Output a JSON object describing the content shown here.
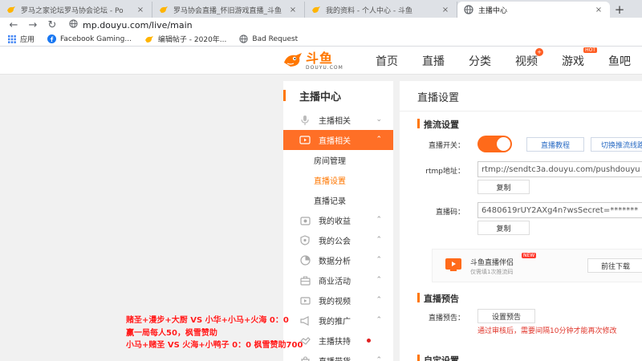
{
  "browser": {
    "tabs": [
      {
        "title": "罗马之家论坛罗马协会论坛 - Po",
        "close": "×",
        "icon": "bird-icon"
      },
      {
        "title": "罗马协会直播_怀旧游戏直播_斗鱼",
        "close": "×",
        "icon": "bird-icon"
      },
      {
        "title": "我的资料 - 个人中心 - 斗鱼",
        "close": "×",
        "icon": "bird-icon"
      },
      {
        "title": "主播中心",
        "close": "×",
        "icon": "globe-icon"
      }
    ],
    "new_tab": "+",
    "back": "←",
    "forward": "→",
    "reload": "↻",
    "url": "mp.douyu.com/live/main",
    "bookmarks": [
      {
        "label": "应用",
        "icon": "apps-icon"
      },
      {
        "label": "Facebook Gaming...",
        "icon": "facebook-icon"
      },
      {
        "label": "编辑帖子 - 2020年...",
        "icon": "bird-icon"
      },
      {
        "label": "Bad Request",
        "icon": "globe-icon"
      }
    ]
  },
  "site": {
    "logo_cn": "斗鱼",
    "logo_en": "DOUYU.COM",
    "nav": [
      "首页",
      "直播",
      "分类",
      "视频",
      "游戏",
      "鱼吧"
    ],
    "video_badge": "+",
    "game_badge": "HOT"
  },
  "sidebar": {
    "title": "主播中心",
    "items": [
      {
        "label": "主播相关",
        "icon": "microphone-icon",
        "chevron": "⌄"
      },
      {
        "label": "直播相关",
        "icon": "live-tv-icon",
        "chevron": "⌃"
      },
      {
        "label": "我的收益",
        "icon": "wallet-icon",
        "chevron": "⌃"
      },
      {
        "label": "我的公会",
        "icon": "shield-icon",
        "chevron": "⌃"
      },
      {
        "label": "数据分析",
        "icon": "pie-chart-icon",
        "chevron": "⌃"
      },
      {
        "label": "商业活动",
        "icon": "briefcase-icon",
        "chevron": "⌃"
      },
      {
        "label": "我的视频",
        "icon": "video-icon",
        "chevron": "⌃"
      },
      {
        "label": "我的推广",
        "icon": "megaphone-icon",
        "chevron": "⌃"
      },
      {
        "label": "主播扶持",
        "icon": "support-icon",
        "chevron": ""
      },
      {
        "label": "直播带货",
        "icon": "shopping-icon",
        "chevron": "⌃"
      }
    ],
    "sub_items": [
      "房间管理",
      "直播设置",
      "直播记录"
    ]
  },
  "main": {
    "title": "直播设置",
    "sections": {
      "push": "推流设置",
      "preview": "直播预告",
      "custom": "自定设置"
    },
    "switch_label": "直播开关：",
    "switch_on": true,
    "tutorial_button": "直播教程",
    "switch_line_button": "切换推流线路",
    "rtmp_label": "rtmp地址：",
    "rtmp_value": "rtmp://sendtc3a.douyu.com/pushdouyu",
    "copy_button": "复制",
    "code_label": "直播码：",
    "code_value": "6480619rUY2AXg4n?wsSecret=*******",
    "promo_name": "斗鱼直播伴侣",
    "promo_new": "NEW",
    "promo_desc": "仅需填1次推流码",
    "promo_button": "前往下载",
    "preview_label": "直播预告：",
    "preview_button": "设置预告",
    "preview_notice": "通过审核后，需要间隔10分钟才能再次修改"
  },
  "overlay": [
    "赌圣+漫步+大厨  VS  小华+小马+火海   0：0",
    "赢一局每人50，枫雪赞助",
    "小马+赌圣  VS  火海+小鸭子  0：0  枫雪赞助700"
  ],
  "colors": {
    "accent": "#ff7700",
    "active_bg": "#ff6f26",
    "overlay_text": "#ff1a1a",
    "link": "#2b6cc4"
  }
}
